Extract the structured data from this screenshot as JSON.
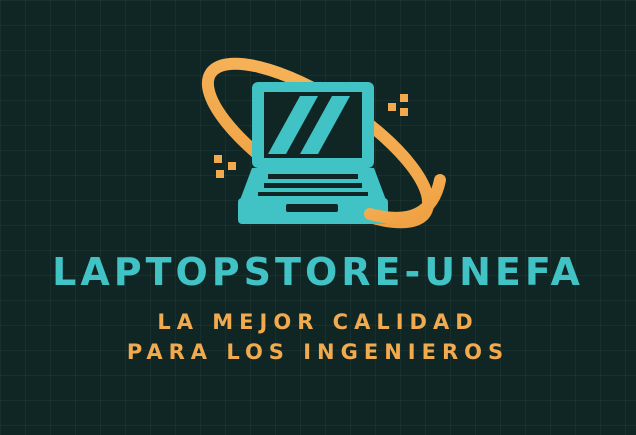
{
  "brand": {
    "name": "LAPTOPSTORE-UNEFA",
    "tagline_line1": "LA MEJOR CALIDAD",
    "tagline_line2": "PARA LOS INGENIEROS"
  },
  "logo": {
    "icon": "laptop-orbit-icon",
    "colors": {
      "background": "#0f2624",
      "teal": "#41c2c4",
      "orange": "#f2aa4f"
    }
  }
}
